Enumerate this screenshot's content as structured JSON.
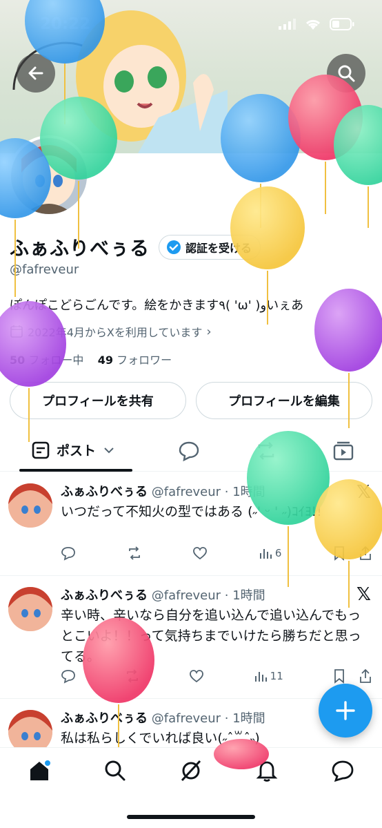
{
  "status_bar": {
    "time": "20:22"
  },
  "profile": {
    "display_name": "ふぁふりべぅる",
    "verify_label": "認証を受ける",
    "handle": "@fafreveur",
    "bio": "ぽんぽこどらごんです。絵をかきます٩( 'ω' )وいぇあ",
    "joined": "2022年4月からXを利用しています",
    "following_count": "50",
    "following_label": "フォロー中",
    "followers_count": "49",
    "followers_label": "フォロワー",
    "share_button": "プロフィールを共有",
    "edit_button": "プロフィールを編集"
  },
  "tabs": {
    "active_label": "ポスト"
  },
  "posts": [
    {
      "name": "ふぁふりべぅる",
      "meta": "@fafreveur · 1時間",
      "text": "いつだって不知火の型ではある (˶' ᵕ ' ˶)ｺｲﾖ!!",
      "views": "6"
    },
    {
      "name": "ふぁふりべぅる",
      "meta": "@fafreveur · 1時間",
      "text": "辛い時、辛いなら自分を追い込んで追い込んでもっとこいよ！！って気持ちまでいけたら勝ちだと思ってる。",
      "views": "11"
    },
    {
      "name": "ふぁふりべぅる",
      "meta": "@fafreveur · 1時間",
      "text": "私は私らしくでいれば良い(˶ˆ꒳ˆ˵)",
      "views": ""
    }
  ],
  "colors": {
    "accent": "#1d9bf0",
    "text": "#0f1419",
    "muted": "#536471"
  }
}
